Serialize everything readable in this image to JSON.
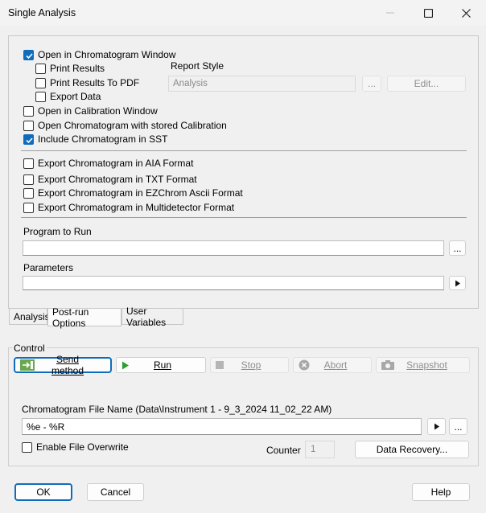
{
  "window": {
    "title": "Single Analysis",
    "minimize_icon": "minimize-icon",
    "maximize_icon": "maximize-icon",
    "close_icon": "close-icon"
  },
  "options": {
    "open_chromatogram_window": "Open in Chromatogram Window",
    "print_results": "Print Results",
    "print_results_pdf": "Print Results To PDF",
    "export_data": "Export Data",
    "report_style_label": "Report Style",
    "report_style_value": "Analysis",
    "browse_label": "...",
    "edit_label": "Edit...",
    "open_calibration_window": "Open in Calibration Window",
    "open_with_stored_calibration": "Open Chromatogram with stored Calibration",
    "include_in_sst": "Include Chromatogram in SST",
    "export_aia": "Export Chromatogram in AIA Format",
    "export_txt": "Export Chromatogram in TXT Format",
    "export_ezchrom": "Export Chromatogram in EZChrom Ascii Format",
    "export_multidetector": "Export Chromatogram in Multidetector Format",
    "program_to_run_label": "Program to Run",
    "program_to_run_value": "",
    "program_browse_label": "...",
    "parameters_label": "Parameters",
    "parameters_value": ""
  },
  "tabs": [
    "Analysis",
    "Post-run Options",
    "User Variables"
  ],
  "control": {
    "label": "Control",
    "send_method": "Send method",
    "run": "Run",
    "stop": "Stop",
    "abort": "Abort",
    "snapshot": "Snapshot",
    "file_name_label": "Chromatogram File Name (Data\\Instrument 1 - 9_3_2024 11_02_22 AM)",
    "file_name_value": "%e - %R",
    "file_browse_label": "...",
    "enable_overwrite": "Enable File Overwrite",
    "counter_label": "Counter",
    "counter_value": "1",
    "data_recovery": "Data Recovery..."
  },
  "footer": {
    "ok": "OK",
    "cancel": "Cancel",
    "help": "Help"
  },
  "colors": {
    "checkbox_accent": "#0f6cbd",
    "run_green": "#2e9e2e",
    "focus_blue": "#0f6cbd"
  }
}
